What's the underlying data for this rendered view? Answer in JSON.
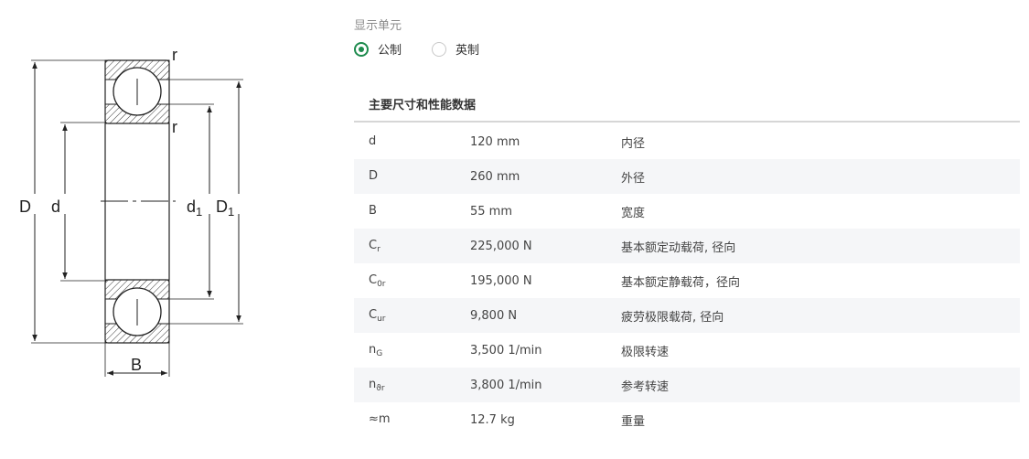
{
  "diagram": {
    "labels": {
      "r_top": "r",
      "r_mid": "r",
      "D_outer": "D",
      "d_inner": "d",
      "d1_base": "d",
      "d1_sub": "1",
      "D1_base": "D",
      "D1_sub": "1",
      "B": "B"
    }
  },
  "units": {
    "label": "显示单元",
    "options": [
      {
        "label": "公制",
        "selected": true
      },
      {
        "label": "英制",
        "selected": false
      }
    ]
  },
  "table": {
    "title": "主要尺寸和性能数据",
    "rows": [
      {
        "sym": "d",
        "sub": "",
        "value": "120 mm",
        "desc": "内径"
      },
      {
        "sym": "D",
        "sub": "",
        "value": "260 mm",
        "desc": "外径"
      },
      {
        "sym": "B",
        "sub": "",
        "value": "55 mm",
        "desc": "宽度"
      },
      {
        "sym": "C",
        "sub": "r",
        "value": "225,000 N",
        "desc": "基本额定动载荷, 径向"
      },
      {
        "sym": "C",
        "sub": "0r",
        "value": "195,000 N",
        "desc": "基本额定静载荷，径向"
      },
      {
        "sym": "C",
        "sub": "ur",
        "value": "9,800 N",
        "desc": "疲劳极限载荷, 径向"
      },
      {
        "sym": "n",
        "sub": "G",
        "value": "3,500 1/min",
        "desc": "极限转速"
      },
      {
        "sym": "n",
        "sub": "ϑr",
        "value": "3,800 1/min",
        "desc": "参考转速"
      },
      {
        "sym": "≈m",
        "sub": "",
        "value": "12.7 kg",
        "desc": "重量"
      }
    ]
  }
}
